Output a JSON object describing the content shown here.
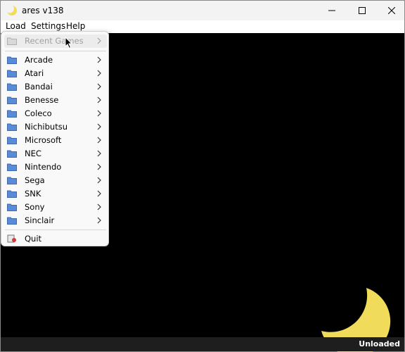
{
  "window": {
    "title": "ares v138",
    "app_icon": "crescent-moon-icon",
    "controls": [
      "minimize-icon",
      "maximize-icon",
      "close-icon"
    ]
  },
  "menubar": {
    "items": [
      "Load",
      "Settings",
      "Help"
    ]
  },
  "load_menu": {
    "recent_games": "Recent Games",
    "systems": [
      "Arcade",
      "Atari",
      "Bandai",
      "Benesse",
      "Coleco",
      "Nichibutsu",
      "Microsoft",
      "NEC",
      "Nintendo",
      "Sega",
      "SNK",
      "Sony",
      "Sinclair"
    ],
    "quit": "Quit"
  },
  "status": {
    "text": "Unloaded"
  },
  "colors": {
    "titlebar": "#f3f3f3",
    "menubar": "#ffffff",
    "screen": "#000000",
    "statusbar": "#1e1e1e",
    "moon": "#f0dc5a",
    "folder": "#5b8bd6"
  }
}
